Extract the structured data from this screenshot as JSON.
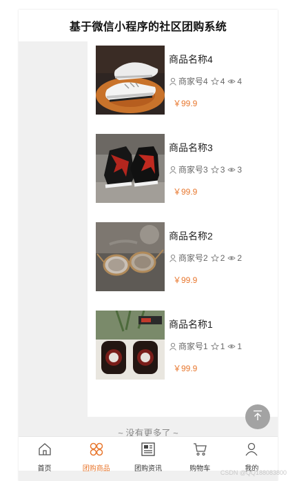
{
  "header": {
    "title": "基于微信小程序的社区团购系统"
  },
  "products": [
    {
      "name": "商品名称4",
      "merchant": "商家号4",
      "favorites": "4",
      "views": "4",
      "price": "￥99.9",
      "image_icon": "white-sneaker-photo"
    },
    {
      "name": "商品名称3",
      "merchant": "商家号3",
      "favorites": "3",
      "views": "3",
      "price": "￥99.9",
      "image_icon": "black-red-hightop-sneaker-photo"
    },
    {
      "name": "商品名称2",
      "merchant": "商家号2",
      "favorites": "2",
      "views": "2",
      "price": "￥99.9",
      "image_icon": "round-sunglasses-photo"
    },
    {
      "name": "商品名称1",
      "merchant": "商家号1",
      "favorites": "1",
      "views": "1",
      "price": "￥99.9",
      "image_icon": "desktop-speakers-photo"
    }
  ],
  "list_footer": "~ 没有更多了 ~",
  "tabbar": {
    "items": [
      {
        "label": "首页",
        "icon": "home-icon"
      },
      {
        "label": "团购商品",
        "icon": "grid-icon",
        "active": true
      },
      {
        "label": "团购资讯",
        "icon": "news-icon"
      },
      {
        "label": "购物车",
        "icon": "cart-icon"
      },
      {
        "label": "我的",
        "icon": "user-icon"
      }
    ]
  },
  "watermark": "CSDN @QQ188083800",
  "colors": {
    "accent": "#e8772e",
    "background": "#f0f0f0",
    "back_top": "#a3a3a3"
  }
}
